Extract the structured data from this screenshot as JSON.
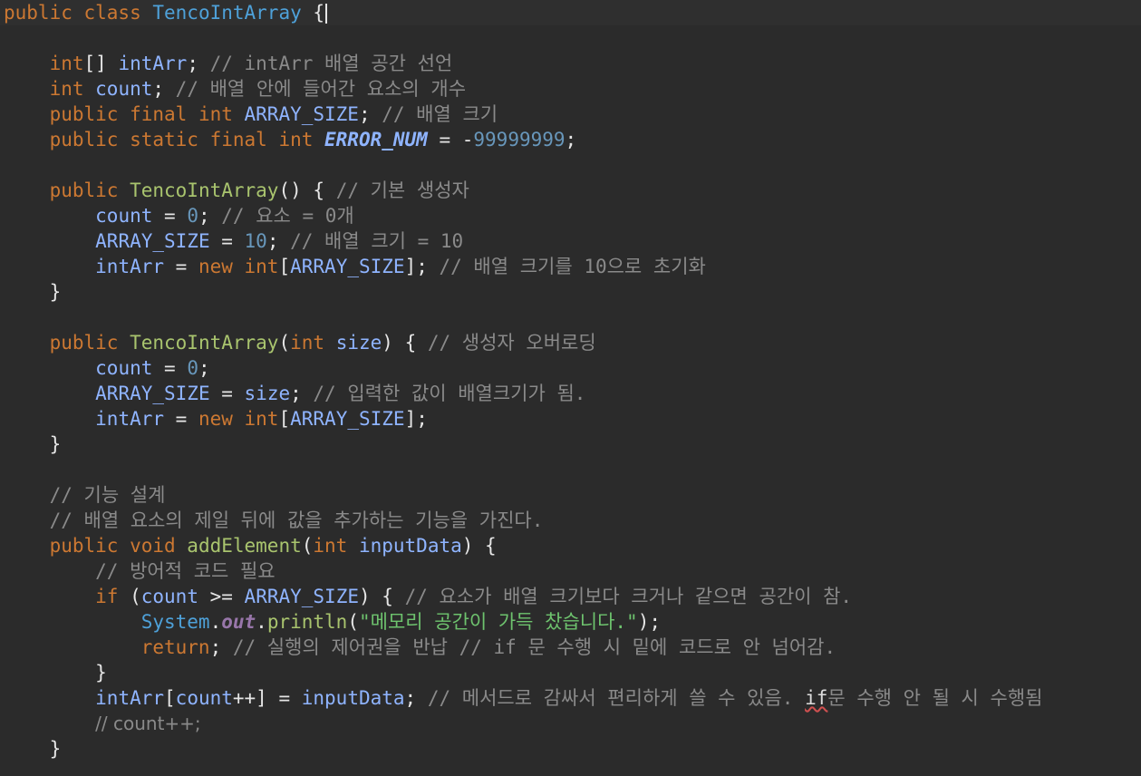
{
  "editor": {
    "lines": [
      {
        "tokens": [
          [
            "kw",
            "public class "
          ],
          [
            "cls",
            "TencoIntArray"
          ],
          [
            "plain",
            " {"
          ]
        ],
        "caret": true,
        "current": true
      },
      {
        "tokens": []
      },
      {
        "tokens": [
          [
            "plain",
            "    "
          ],
          [
            "kw",
            "int"
          ],
          [
            "plain",
            "[] "
          ],
          [
            "var",
            "intArr"
          ],
          [
            "plain",
            "; "
          ],
          [
            "cmt",
            "// intArr 배열 공간 선언"
          ]
        ]
      },
      {
        "tokens": [
          [
            "plain",
            "    "
          ],
          [
            "kw",
            "int "
          ],
          [
            "var",
            "count"
          ],
          [
            "plain",
            "; "
          ],
          [
            "cmt",
            "// 배열 안에 들어간 요소의 개수"
          ]
        ]
      },
      {
        "tokens": [
          [
            "plain",
            "    "
          ],
          [
            "kw",
            "public final int "
          ],
          [
            "cnst",
            "ARRAY_SIZE"
          ],
          [
            "plain",
            "; "
          ],
          [
            "cmt",
            "// 배열 크기"
          ]
        ]
      },
      {
        "tokens": [
          [
            "plain",
            "    "
          ],
          [
            "kw",
            "public static final int "
          ],
          [
            "static-const",
            "ERROR_NUM"
          ],
          [
            "plain",
            " = -"
          ],
          [
            "num",
            "99999999"
          ],
          [
            "plain",
            ";"
          ]
        ]
      },
      {
        "tokens": []
      },
      {
        "tokens": [
          [
            "plain",
            "    "
          ],
          [
            "kw",
            "public "
          ],
          [
            "fn",
            "TencoIntArray"
          ],
          [
            "plain",
            "() { "
          ],
          [
            "cmt",
            "// 기본 생성자"
          ]
        ]
      },
      {
        "tokens": [
          [
            "plain",
            "        "
          ],
          [
            "var",
            "count"
          ],
          [
            "plain",
            " = "
          ],
          [
            "num",
            "0"
          ],
          [
            "plain",
            "; "
          ],
          [
            "cmt",
            "// 요소 = 0개"
          ]
        ]
      },
      {
        "tokens": [
          [
            "plain",
            "        "
          ],
          [
            "cnst",
            "ARRAY_SIZE"
          ],
          [
            "plain",
            " = "
          ],
          [
            "num",
            "10"
          ],
          [
            "plain",
            "; "
          ],
          [
            "cmt",
            "// 배열 크기 = 10"
          ]
        ]
      },
      {
        "tokens": [
          [
            "plain",
            "        "
          ],
          [
            "var",
            "intArr"
          ],
          [
            "plain",
            " = "
          ],
          [
            "kw",
            "new int"
          ],
          [
            "plain",
            "["
          ],
          [
            "cnst",
            "ARRAY_SIZE"
          ],
          [
            "plain",
            "]; "
          ],
          [
            "cmt",
            "// 배열 크기를 10으로 초기화"
          ]
        ]
      },
      {
        "tokens": [
          [
            "plain",
            "    }"
          ]
        ]
      },
      {
        "tokens": []
      },
      {
        "tokens": [
          [
            "plain",
            "    "
          ],
          [
            "kw",
            "public "
          ],
          [
            "fn",
            "TencoIntArray"
          ],
          [
            "plain",
            "("
          ],
          [
            "kw",
            "int "
          ],
          [
            "var",
            "size"
          ],
          [
            "plain",
            ") { "
          ],
          [
            "cmt",
            "// 생성자 오버로딩"
          ]
        ]
      },
      {
        "tokens": [
          [
            "plain",
            "        "
          ],
          [
            "var",
            "count"
          ],
          [
            "plain",
            " = "
          ],
          [
            "num",
            "0"
          ],
          [
            "plain",
            ";"
          ]
        ]
      },
      {
        "tokens": [
          [
            "plain",
            "        "
          ],
          [
            "cnst",
            "ARRAY_SIZE"
          ],
          [
            "plain",
            " = "
          ],
          [
            "var",
            "size"
          ],
          [
            "plain",
            "; "
          ],
          [
            "cmt",
            "// 입력한 값이 배열크기가 됨."
          ]
        ]
      },
      {
        "tokens": [
          [
            "plain",
            "        "
          ],
          [
            "var",
            "intArr"
          ],
          [
            "plain",
            " = "
          ],
          [
            "kw",
            "new int"
          ],
          [
            "plain",
            "["
          ],
          [
            "cnst",
            "ARRAY_SIZE"
          ],
          [
            "plain",
            "];"
          ]
        ]
      },
      {
        "tokens": [
          [
            "plain",
            "    }"
          ]
        ]
      },
      {
        "tokens": []
      },
      {
        "tokens": [
          [
            "plain",
            "    "
          ],
          [
            "cmt",
            "// 기능 설계"
          ]
        ]
      },
      {
        "tokens": [
          [
            "plain",
            "    "
          ],
          [
            "cmt",
            "// 배열 요소의 제일 뒤에 값을 추가하는 기능을 가진다."
          ]
        ]
      },
      {
        "tokens": [
          [
            "plain",
            "    "
          ],
          [
            "kw",
            "public void "
          ],
          [
            "fn",
            "addElement"
          ],
          [
            "plain",
            "("
          ],
          [
            "kw",
            "int "
          ],
          [
            "var",
            "inputData"
          ],
          [
            "plain",
            ") {"
          ]
        ]
      },
      {
        "tokens": [
          [
            "plain",
            "        "
          ],
          [
            "cmt",
            "// 방어적 코드 필요"
          ]
        ]
      },
      {
        "tokens": [
          [
            "plain",
            "        "
          ],
          [
            "kw",
            "if "
          ],
          [
            "plain",
            "("
          ],
          [
            "var",
            "count"
          ],
          [
            "plain",
            " >= "
          ],
          [
            "cnst",
            "ARRAY_SIZE"
          ],
          [
            "plain",
            ") { "
          ],
          [
            "cmt",
            "// 요소가 배열 크기보다 크거나 같으면 공간이 참."
          ]
        ]
      },
      {
        "tokens": [
          [
            "plain",
            "            "
          ],
          [
            "cls",
            "System"
          ],
          [
            "plain",
            "."
          ],
          [
            "field-static",
            "out"
          ],
          [
            "plain",
            "."
          ],
          [
            "fn",
            "println"
          ],
          [
            "plain",
            "("
          ],
          [
            "str",
            "\"메모리 공간이 가득 찼습니다.\""
          ],
          [
            "plain",
            ");"
          ]
        ]
      },
      {
        "tokens": [
          [
            "plain",
            "            "
          ],
          [
            "kw",
            "return"
          ],
          [
            "plain",
            "; "
          ],
          [
            "cmt",
            "// 실행의 제어권을 반납 // if 문 수행 시 밑에 코드로 안 넘어감."
          ]
        ]
      },
      {
        "tokens": [
          [
            "plain",
            "        }"
          ]
        ]
      },
      {
        "tokens": [
          [
            "plain",
            "        "
          ],
          [
            "var",
            "intArr"
          ],
          [
            "plain",
            "["
          ],
          [
            "var",
            "count"
          ],
          [
            "plain",
            "++] = "
          ],
          [
            "var",
            "inputData"
          ],
          [
            "plain",
            "; "
          ],
          [
            "cmt",
            "// 메서드로 감싸서 편리하게 쓸 수 있음. "
          ],
          [
            "squiggle",
            "if"
          ],
          [
            "cmt",
            "문 수행 안 될 시 수행됨"
          ]
        ]
      },
      {
        "tokens": [
          [
            "plain",
            "        "
          ],
          [
            "cmt-line",
            "// count++;"
          ]
        ]
      },
      {
        "tokens": [
          [
            "plain",
            "    }"
          ]
        ]
      }
    ]
  }
}
